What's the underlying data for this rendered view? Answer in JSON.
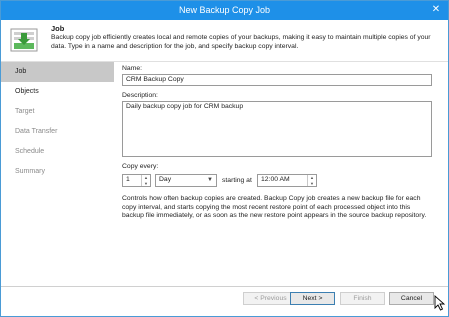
{
  "window": {
    "title": "New Backup Copy Job",
    "close_glyph": "✕"
  },
  "header": {
    "title": "Job",
    "description": "Backup copy job efficiently creates local and remote copies of your backups, making it easy to maintain multiple copies of your data. Type in a name and description for the job, and specify backup copy interval.",
    "icon": "backup-copy-job-icon"
  },
  "sidebar": {
    "items": [
      {
        "label": "Job",
        "state": "active"
      },
      {
        "label": "Objects",
        "state": "current"
      },
      {
        "label": "Target",
        "state": "inactive"
      },
      {
        "label": "Data Transfer",
        "state": "inactive"
      },
      {
        "label": "Schedule",
        "state": "inactive"
      },
      {
        "label": "Summary",
        "state": "inactive"
      }
    ]
  },
  "form": {
    "name_label": "Name:",
    "name_value": "CRM Backup Copy",
    "description_label": "Description:",
    "description_value": "Daily backup copy job for CRM backup",
    "copy_every_label": "Copy every:",
    "interval_value": "1",
    "interval_unit": "Day",
    "starting_at_label": "starting at",
    "start_time": "12:00 AM",
    "help_text": "Controls how often backup copies are created. Backup Copy job creates a new backup file for each copy interval, and starts copying the most recent restore point of each processed object into this backup file immediately, or as soon as the new restore point appears in the source backup repository."
  },
  "footer": {
    "previous_label": "< Previous",
    "next_label": "Next >",
    "finish_label": "Finish",
    "cancel_label": "Cancel"
  },
  "colors": {
    "titlebar": "#1e90e8",
    "active_nav": "#c8c8c8",
    "accent_green": "#5cb85c"
  }
}
